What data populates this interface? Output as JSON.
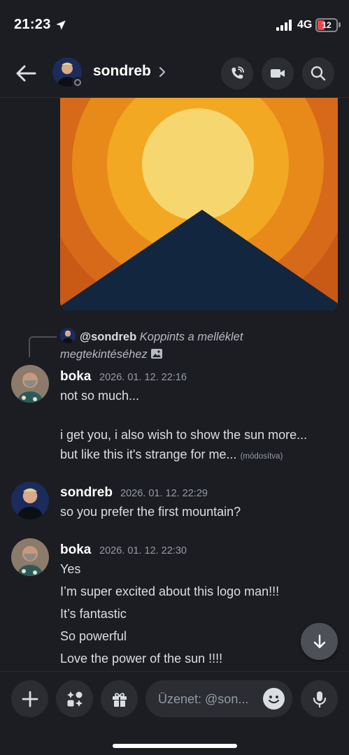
{
  "status_bar": {
    "time": "21:23",
    "network": "4G",
    "battery": "12"
  },
  "header": {
    "username": "sondreb"
  },
  "reply": {
    "user": "@sondreb",
    "text": "Koppints a melléklet megtekintéséhez"
  },
  "messages": [
    {
      "author": "boka",
      "timestamp": "2026. 01. 12. 22:16",
      "lines": [
        "not so much...",
        "i get you, i also wish to show the sun more...",
        "but like this it's strange for me..."
      ],
      "edited_label": "(módosítva)"
    },
    {
      "author": "sondreb",
      "timestamp": "2026. 01. 12. 22:29",
      "lines": [
        "so you prefer the first mountain?"
      ]
    },
    {
      "author": "boka",
      "timestamp": "2026. 01. 12. 22:30",
      "lines": [
        "Yes",
        "I’m super excited about this logo man!!!",
        "It’s fantastic",
        "So powerful",
        "Love the power of the sun !!!!"
      ]
    }
  ],
  "composer": {
    "placeholder": "Üzenet: @son..."
  },
  "colors": {
    "background": "#1c1d22",
    "sun_outer": "#e07b17",
    "sun_mid": "#f3a11c",
    "sun_core": "#f6d56a",
    "mountain": "#122a45"
  },
  "icons": [
    "back-arrow-icon",
    "chevron-right-icon",
    "phone-icon",
    "video-camera-icon",
    "search-icon",
    "image-icon",
    "arrow-down-icon",
    "plus-icon",
    "apps-icon",
    "gift-icon",
    "emoji-icon",
    "microphone-icon"
  ]
}
